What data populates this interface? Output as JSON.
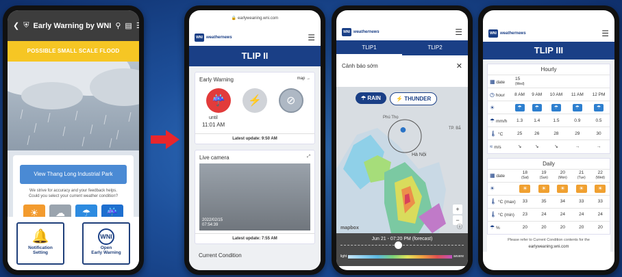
{
  "colors": {
    "brand": "#1a3f86",
    "flood_banner": "#f6c624",
    "arrow": "#e8262c",
    "rain_button": "#4a8ad4"
  },
  "phone1": {
    "title": "Early Warning by WNI",
    "icons": [
      "back-icon",
      "shield-icon",
      "search-icon",
      "document-icon",
      "menu-icon"
    ],
    "banner": "POSSIBLE SMALL SCALE FLOOD",
    "park_button": "View Thang Long Industrial Park",
    "feedback_line1": "We strive for accuracy and your feedback helps.",
    "feedback_line2": "Could you select your current weather condition?",
    "weather_options": [
      "sunny",
      "cloudy",
      "rainy",
      "heavy-rain"
    ],
    "notification_label_1": "Notification",
    "notification_label_2": "Setting",
    "open_label_1": "Open",
    "open_label_2": "Early Warning",
    "logo_text": "WNI"
  },
  "phone2": {
    "url": "earlyweaning.wni.com",
    "logo_text": "weathernews",
    "logo_badge": "WNI",
    "title": "TLIP II",
    "early_warning": {
      "heading": "Early Warning",
      "map_link": "map →",
      "until_label": "until",
      "until_time": "11:01 AM",
      "update": "Latest update: 9:50 AM"
    },
    "live_camera": {
      "heading": "Live camera",
      "date": "2022/02/15",
      "time": "07:54:39",
      "update": "Latest update: 7:55 AM"
    },
    "next_section": "Current Condition"
  },
  "phone3": {
    "logo_text": "weathernews",
    "logo_badge": "WNI",
    "tabs": [
      "TLIP1",
      "TLIP2"
    ],
    "alert_title": "Cảnh báo sớm",
    "rain_button": "RAIN",
    "thunder_button": "THUNDER",
    "places": [
      "Phú Thọ",
      "Hà Nội",
      "TP. Bắ"
    ],
    "mapbox_label": "mapbox",
    "forecast_label": "Jun 21 - 07:20 PM (forecast)",
    "legend_light": "light",
    "legend_severe": "severe"
  },
  "phone4": {
    "logo_text": "weathernews",
    "logo_badge": "WNI",
    "title": "TLIP III",
    "hourly": {
      "heading": "Hourly",
      "date_label": "date",
      "date_value": "15",
      "date_day": "(Wed)",
      "hour_label": "hour",
      "hours": [
        "8 AM",
        "9 AM",
        "10 AM",
        "11 AM",
        "12 PM"
      ],
      "mmh_label": "mm/h",
      "mmh": [
        "1.3",
        "1.4",
        "1.5",
        "0.9",
        "0.5"
      ],
      "temp_label": "°C",
      "temps": [
        "25",
        "26",
        "28",
        "29",
        "30"
      ],
      "wind_label": "m/s",
      "winds": [
        "↘",
        "↘",
        "↘",
        "→",
        "→"
      ]
    },
    "daily": {
      "heading": "Daily",
      "date_label": "date",
      "dates": [
        "18",
        "19",
        "20",
        "21",
        "22"
      ],
      "days": [
        "(Sat)",
        "(Sun)",
        "(Mon)",
        "(Tue)",
        "(Wed)"
      ],
      "max_label": "°C (max)",
      "max": [
        "33",
        "35",
        "34",
        "33",
        "33"
      ],
      "min_label": "°C (min)",
      "min": [
        "23",
        "24",
        "24",
        "24",
        "24"
      ],
      "pct_label": "%",
      "pct": [
        "20",
        "20",
        "20",
        "20",
        "20"
      ]
    },
    "footer": "Please refer to Current Condition contents for the",
    "url": "earlyweaning.wni.com"
  }
}
